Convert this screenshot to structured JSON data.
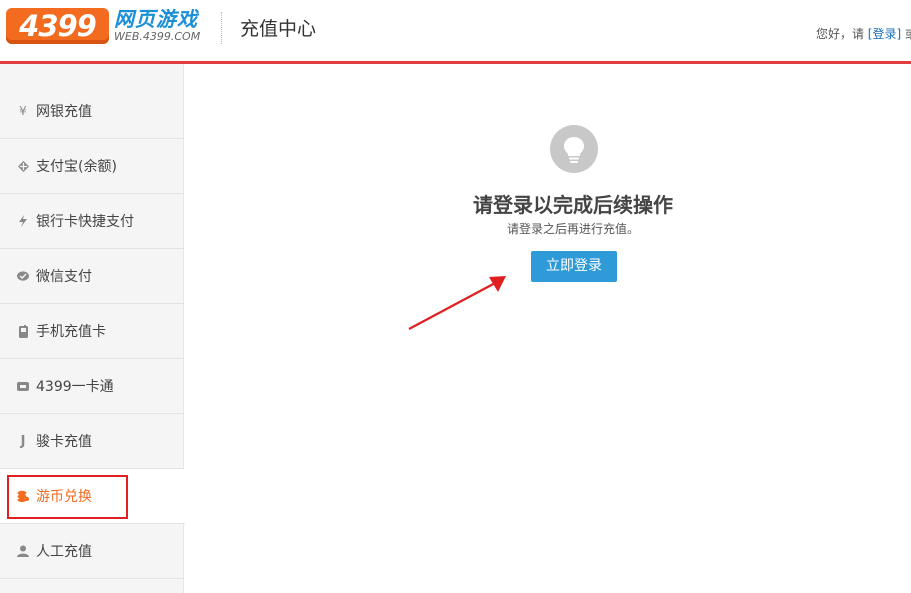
{
  "header": {
    "logo_number": "4399",
    "logo_cn": "网页游戏",
    "logo_url": "WEB.4399.COM",
    "title": "充值中心",
    "greeting": "您好，请",
    "login_link": "[登录]",
    "trailing": "或"
  },
  "sidebar": {
    "items": [
      {
        "label": "网银充值",
        "icon": "yen-icon"
      },
      {
        "label": "支付宝(余额)",
        "icon": "alipay-icon"
      },
      {
        "label": "银行卡快捷支付",
        "icon": "lightning-icon"
      },
      {
        "label": "微信支付",
        "icon": "wechat-icon"
      },
      {
        "label": "手机充值卡",
        "icon": "phone-card-icon"
      },
      {
        "label": "4399一卡通",
        "icon": "card-icon"
      },
      {
        "label": "骏卡充值",
        "icon": "junka-icon"
      },
      {
        "label": "游币兑换",
        "icon": "coins-icon",
        "active": true
      },
      {
        "label": "人工充值",
        "icon": "person-icon"
      }
    ]
  },
  "main": {
    "title": "请登录以完成后续操作",
    "subtitle": "请登录之后再进行充值。",
    "login_button": "立即登录"
  },
  "colors": {
    "brand_orange": "#f26b1f",
    "header_line": "#e23d3d",
    "button_blue": "#2f9ad8",
    "annotation_red": "#e02020"
  }
}
